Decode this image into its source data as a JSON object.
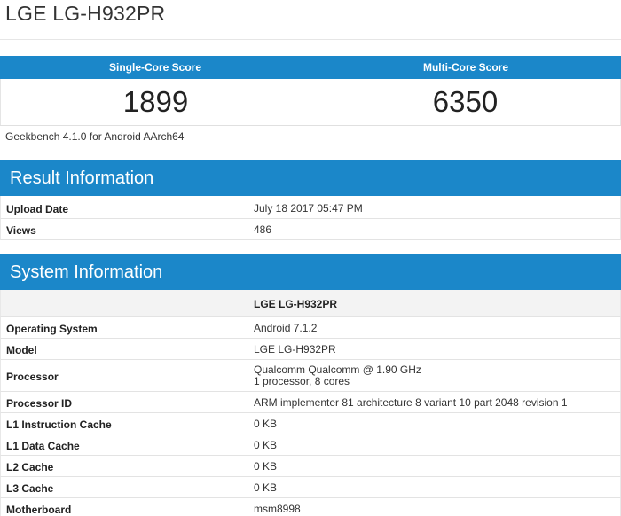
{
  "device_title": "LGE LG-H932PR",
  "scores": {
    "single_label": "Single-Core Score",
    "multi_label": "Multi-Core Score",
    "single_value": "1899",
    "multi_value": "6350"
  },
  "benchmark_version": "Geekbench 4.1.0 for Android AArch64",
  "result_info": {
    "title": "Result Information",
    "rows": [
      {
        "label": "Upload Date",
        "value": "July 18 2017 05:47 PM"
      },
      {
        "label": "Views",
        "value": "486"
      }
    ]
  },
  "system_info": {
    "title": "System Information",
    "column_header": "LGE LG-H932PR",
    "rows": [
      {
        "label": "Operating System",
        "value": "Android 7.1.2"
      },
      {
        "label": "Model",
        "value": "LGE LG-H932PR"
      },
      {
        "label": "Processor",
        "value": "Qualcomm Qualcomm @ 1.90 GHz",
        "value2": "1 processor, 8 cores"
      },
      {
        "label": "Processor ID",
        "value": "ARM implementer 81 architecture 8 variant 10 part 2048 revision 1"
      },
      {
        "label": "L1 Instruction Cache",
        "value": "0 KB"
      },
      {
        "label": "L1 Data Cache",
        "value": "0 KB"
      },
      {
        "label": "L2 Cache",
        "value": "0 KB"
      },
      {
        "label": "L3 Cache",
        "value": "0 KB"
      },
      {
        "label": "Motherboard",
        "value": "msm8998"
      }
    ]
  },
  "colors": {
    "accent": "#1b87c9",
    "row_shade": "#f3f3f3"
  }
}
